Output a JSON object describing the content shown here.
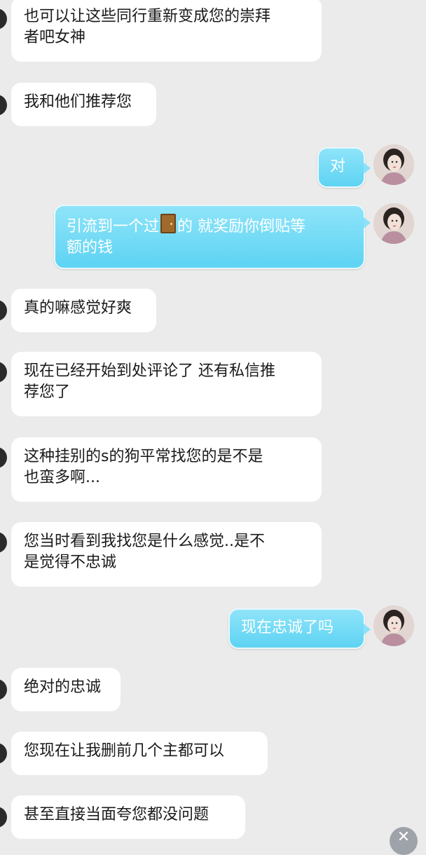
{
  "messages": [
    {
      "side": "in",
      "lines": [
        "也可以让这些同行重新变成您的崇拜",
        "者吧女神"
      ]
    },
    {
      "side": "in",
      "lines": [
        "我和他们推荐您"
      ]
    },
    {
      "side": "out",
      "lines": [
        "对"
      ]
    },
    {
      "side": "out",
      "before": "引流到一个过",
      "emoji": "door-icon",
      "after": "的 就奖励你倒贴等",
      "line2": "额的钱"
    },
    {
      "side": "in",
      "lines": [
        "真的嘛感觉好爽"
      ]
    },
    {
      "side": "in",
      "lines": [
        "现在已经开始到处评论了 还有私信推",
        "荐您了"
      ]
    },
    {
      "side": "in",
      "lines": [
        "这种挂别的s的狗平常找您的是不是",
        "也蛮多啊..."
      ]
    },
    {
      "side": "in",
      "lines": [
        "您当时看到我找您是什么感觉..是不",
        "是觉得不忠诚"
      ]
    },
    {
      "side": "out",
      "lines": [
        "现在忠诚了吗"
      ]
    },
    {
      "side": "in",
      "lines": [
        "绝对的忠诚"
      ]
    },
    {
      "side": "in",
      "lines": [
        "您现在让我删前几个主都可以"
      ]
    },
    {
      "side": "in",
      "lines": [
        "甚至直接当面夸您都没问题"
      ]
    }
  ],
  "fab_icon": "close-icon",
  "fab_glyph": "✕"
}
